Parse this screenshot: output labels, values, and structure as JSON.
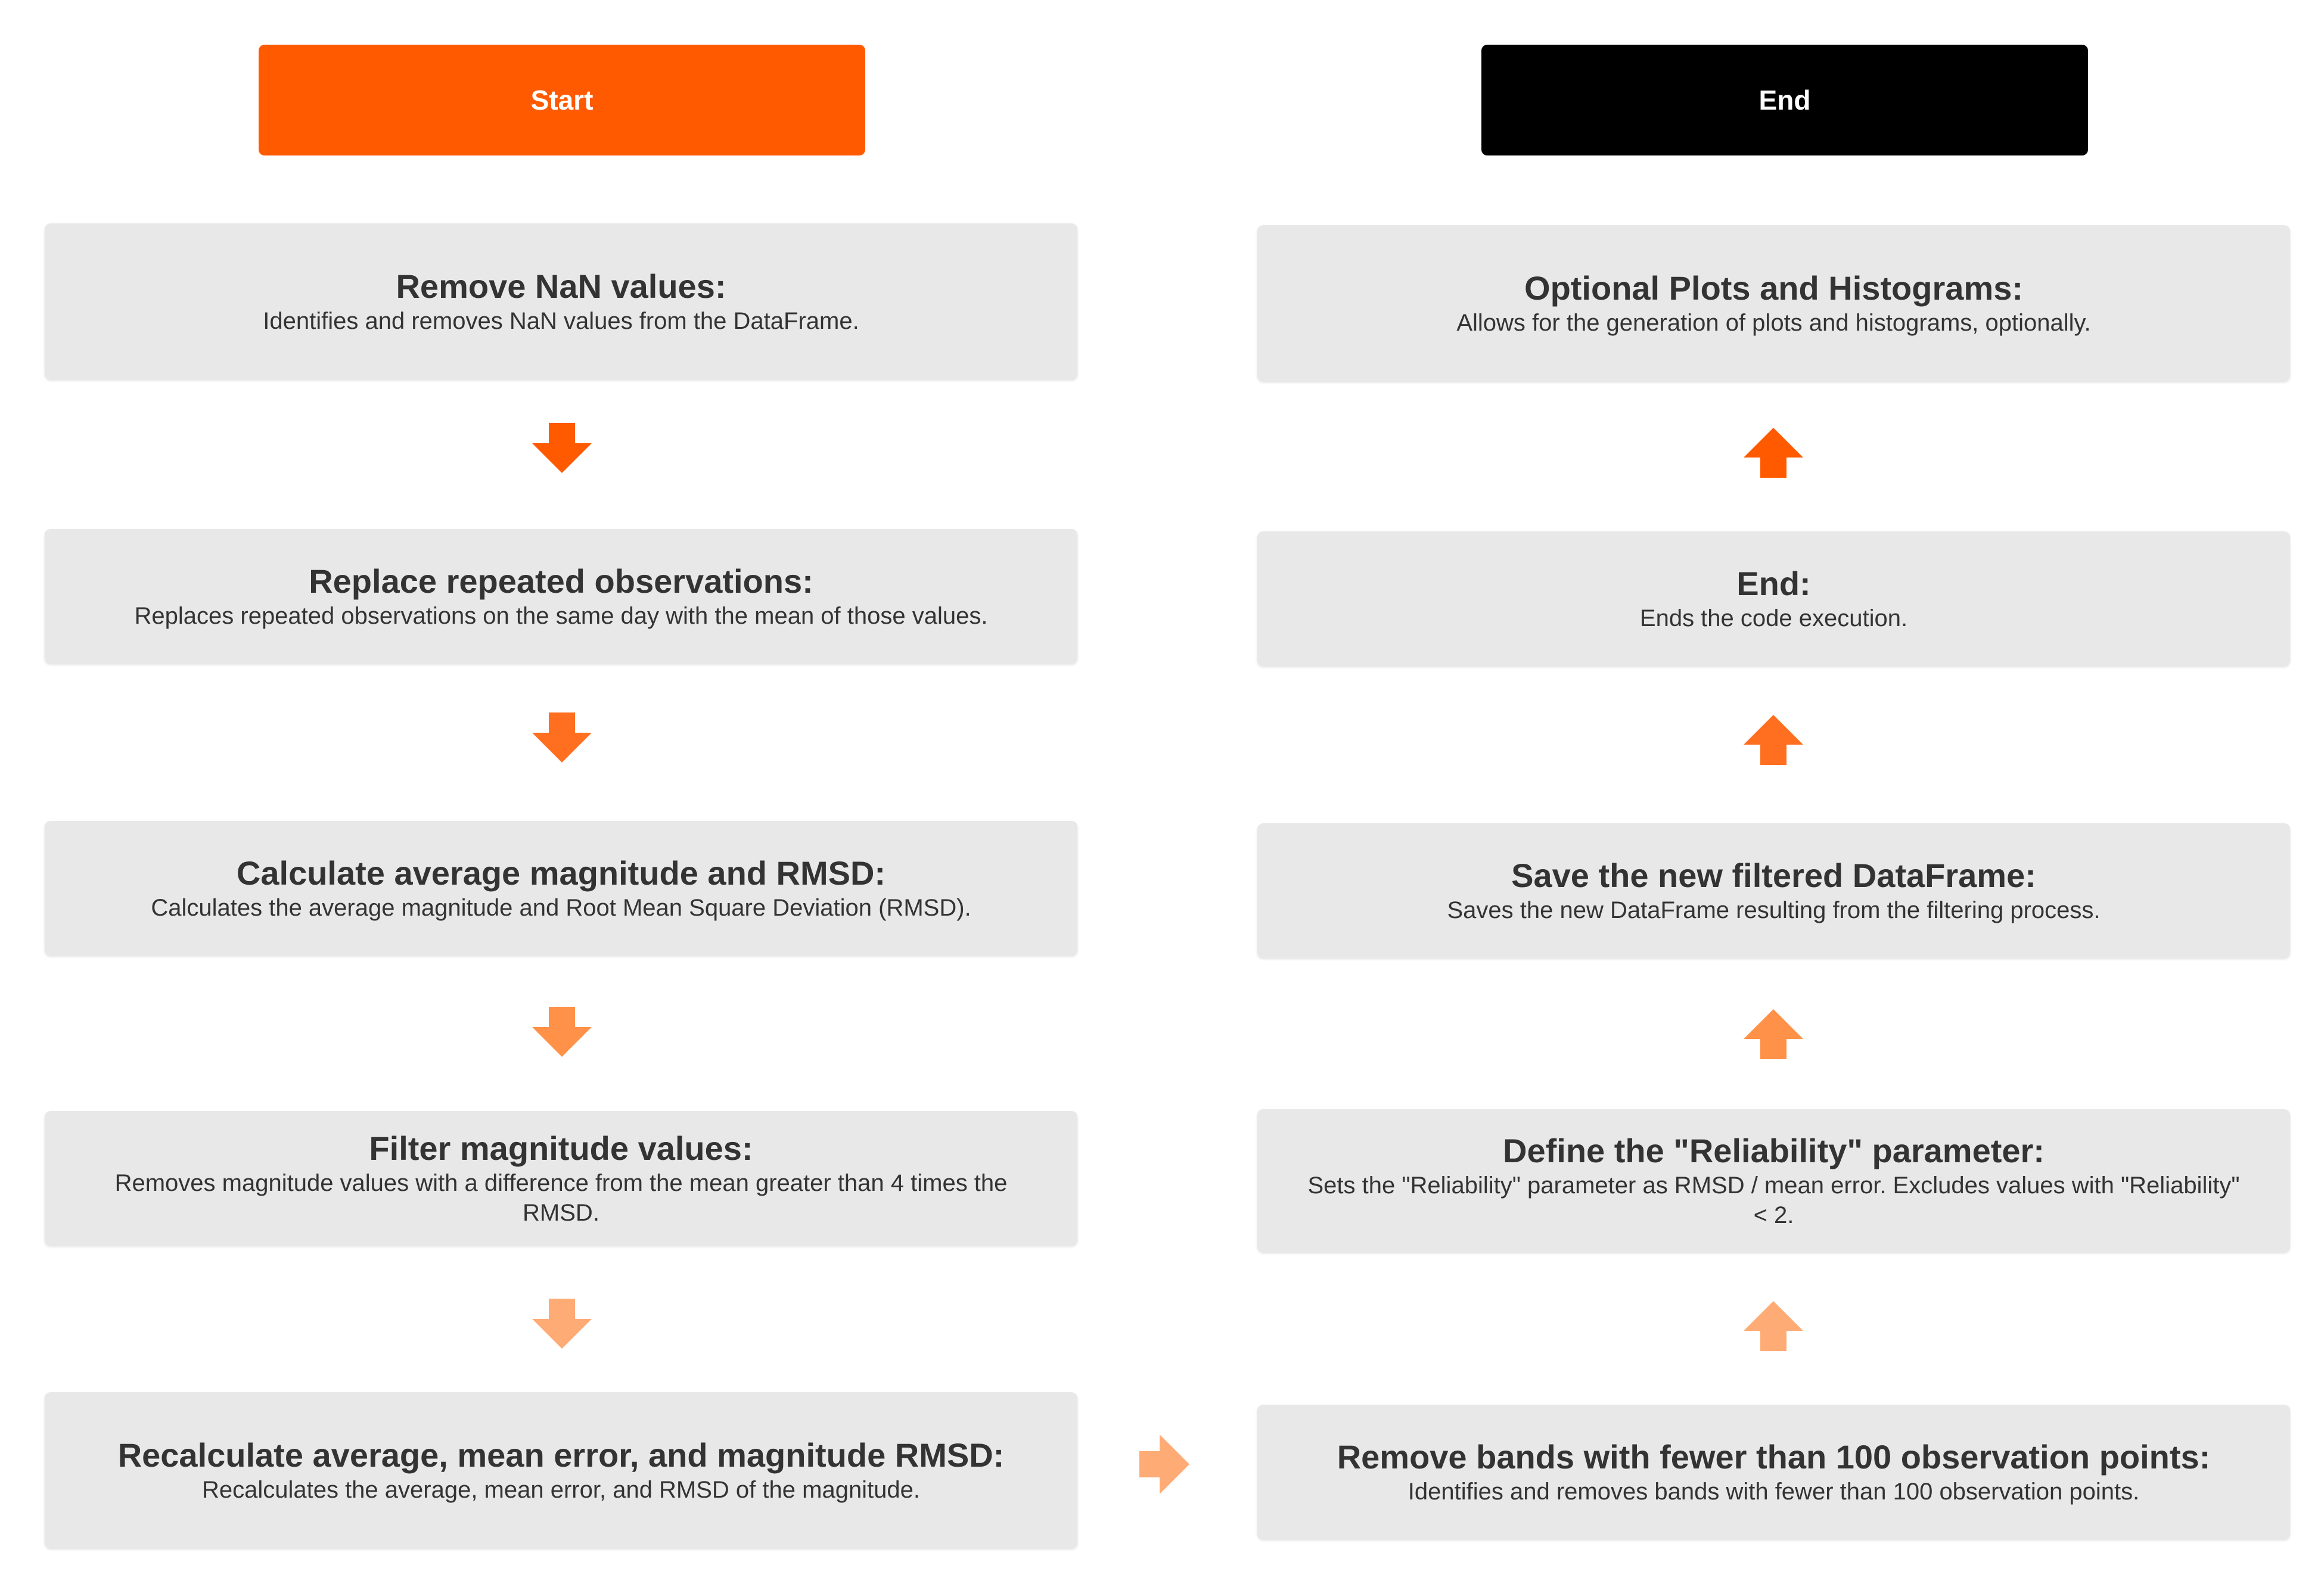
{
  "start_label": "Start",
  "end_label": "End",
  "left_column": [
    {
      "title": "Remove NaN values:",
      "desc": "Identifies and removes NaN values from the DataFrame."
    },
    {
      "title": "Replace repeated observations:",
      "desc": "Replaces repeated observations on the same day with the mean of those values."
    },
    {
      "title": "Calculate average magnitude and RMSD:",
      "desc": "Calculates the average magnitude and Root Mean Square Deviation (RMSD)."
    },
    {
      "title": "Filter magnitude values:",
      "desc": "Removes magnitude values with a difference from the mean greater than 4 times the RMSD."
    },
    {
      "title": "Recalculate average, mean error, and magnitude RMSD:",
      "desc": "Recalculates the average, mean error, and RMSD of the magnitude."
    }
  ],
  "right_column": [
    {
      "title": "Optional Plots and Histograms:",
      "desc": "Allows for the generation of plots and histograms, optionally."
    },
    {
      "title": "End:",
      "desc": "Ends the code execution."
    },
    {
      "title": "Save the new filtered DataFrame:",
      "desc": "Saves the new DataFrame resulting from the filtering process."
    },
    {
      "title": "Define the \"Reliability\" parameter:",
      "desc": "Sets the \"Reliability\" parameter as RMSD / mean error. Excludes values with \"Reliability\" < 2."
    },
    {
      "title": "Remove bands with fewer than 100 observation points:",
      "desc": "Identifies and removes bands with fewer than 100 observation points."
    }
  ],
  "colors": {
    "start": "#ff5a00",
    "end": "#000000",
    "box_bg": "#e8e8e8",
    "arrow_1": "#ff5a00",
    "arrow_2": "#ff6f1f",
    "arrow_3": "#ff9148",
    "arrow_4": "#ffab75",
    "arrow_connector": "#ffab75"
  }
}
